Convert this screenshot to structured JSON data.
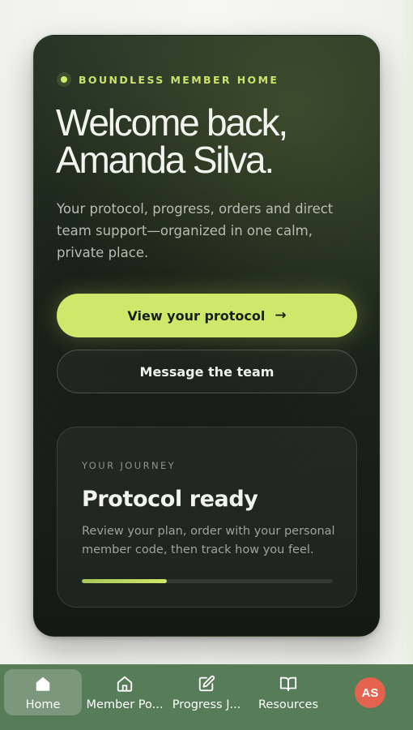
{
  "hero": {
    "eyebrow": "BOUNDLESS MEMBER HOME",
    "title": "Welcome back, Amanda Silva.",
    "subtitle": "Your protocol, progress, orders and direct team support—organized in one calm, private place.",
    "primary_button": "View your protocol",
    "primary_button_icon": "arrow-right-icon",
    "secondary_button": "Message the team"
  },
  "journey": {
    "eyebrow": "YOUR JOURNEY",
    "title": "Protocol ready",
    "description": "Review your plan, order with your personal member code, then track how you feel.",
    "progress_percent": 34
  },
  "tabbar": {
    "tabs": [
      {
        "label": "Home",
        "icon": "home-icon",
        "active": true
      },
      {
        "label": "Member Po...",
        "icon": "house-outline-icon",
        "active": false
      },
      {
        "label": "Progress J...",
        "icon": "edit-icon",
        "active": false
      },
      {
        "label": "Resources",
        "icon": "book-icon",
        "active": false
      }
    ],
    "avatar_initials": "AS"
  },
  "colors": {
    "accent": "#cde86a",
    "card_bg": "#1b251b",
    "tabbar_bg": "#577c58",
    "avatar_bg": "#e3634e"
  }
}
